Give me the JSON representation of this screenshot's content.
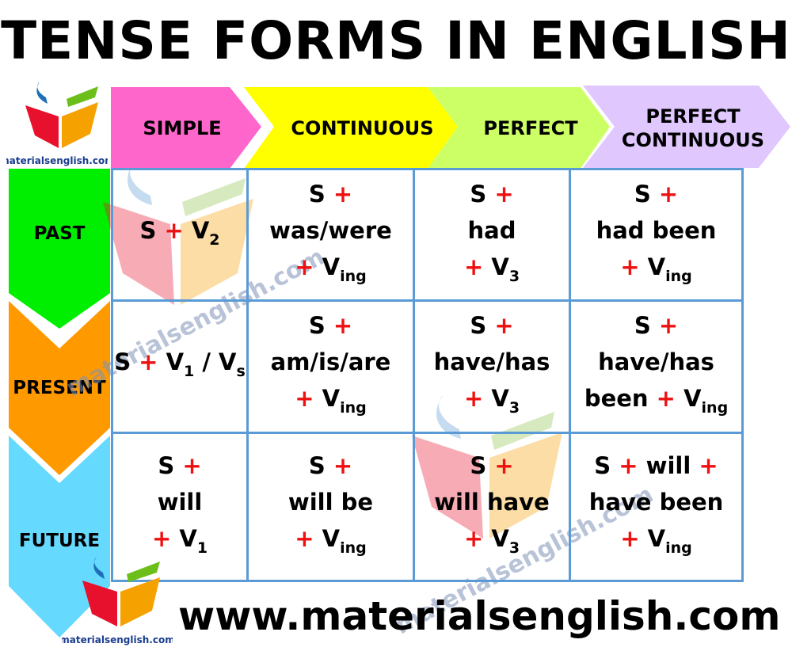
{
  "title": "TENSE FORMS IN ENGLISH",
  "logo": {
    "text": "materialsenglish.com",
    "icon": "open-book-logo-icon"
  },
  "colors": {
    "simple": "#ff66cc",
    "continuous": "#ffff00",
    "perfect": "#ccff66",
    "perfect_continuous": "#e0c8ff",
    "past": "#00ee00",
    "present": "#ff9900",
    "future": "#66d9ff",
    "grid_line": "#5b9bd5",
    "plus": "#ee1111"
  },
  "columns": [
    {
      "label": "SIMPLE"
    },
    {
      "label": "CONTINUOUS"
    },
    {
      "label": "PERFECT"
    },
    {
      "label": "PERFECT CONTINUOUS",
      "line1": "PERFECT",
      "line2": "CONTINUOUS"
    }
  ],
  "rows": [
    {
      "label": "PAST",
      "cells": [
        {
          "lines": [
            [
              {
                "t": "S "
              },
              {
                "p": "+"
              },
              {
                "t": " V"
              },
              {
                "s": "2"
              }
            ]
          ]
        },
        {
          "lines": [
            [
              {
                "t": "S "
              },
              {
                "p": "+"
              }
            ],
            [
              {
                "t": "was/were"
              }
            ],
            [
              {
                "p": "+"
              },
              {
                "t": " V"
              },
              {
                "s": "ing"
              }
            ]
          ]
        },
        {
          "lines": [
            [
              {
                "t": "S "
              },
              {
                "p": "+"
              }
            ],
            [
              {
                "t": "had"
              }
            ],
            [
              {
                "p": "+"
              },
              {
                "t": " V"
              },
              {
                "s": "3"
              }
            ]
          ]
        },
        {
          "lines": [
            [
              {
                "t": "S "
              },
              {
                "p": "+"
              }
            ],
            [
              {
                "t": "had been"
              }
            ],
            [
              {
                "p": "+"
              },
              {
                "t": " V"
              },
              {
                "s": "ing"
              }
            ]
          ]
        }
      ]
    },
    {
      "label": "PRESENT",
      "cells": [
        {
          "lines": [
            [
              {
                "t": "S "
              },
              {
                "p": "+"
              },
              {
                "t": " V"
              },
              {
                "s": "1"
              },
              {
                "t": " / V"
              },
              {
                "s": "s"
              }
            ]
          ]
        },
        {
          "lines": [
            [
              {
                "t": "S "
              },
              {
                "p": "+"
              }
            ],
            [
              {
                "t": "am/is/are"
              }
            ],
            [
              {
                "p": "+"
              },
              {
                "t": " V"
              },
              {
                "s": "ing"
              }
            ]
          ]
        },
        {
          "lines": [
            [
              {
                "t": "S "
              },
              {
                "p": "+"
              }
            ],
            [
              {
                "t": "have/has"
              }
            ],
            [
              {
                "p": "+"
              },
              {
                "t": " V"
              },
              {
                "s": "3"
              }
            ]
          ]
        },
        {
          "lines": [
            [
              {
                "t": "S "
              },
              {
                "p": "+"
              }
            ],
            [
              {
                "t": "have/has"
              }
            ],
            [
              {
                "t": "been "
              },
              {
                "p": "+"
              },
              {
                "t": " V"
              },
              {
                "s": "ing"
              }
            ]
          ]
        }
      ]
    },
    {
      "label": "FUTURE",
      "cells": [
        {
          "lines": [
            [
              {
                "t": "S "
              },
              {
                "p": "+"
              }
            ],
            [
              {
                "t": "will"
              }
            ],
            [
              {
                "p": "+"
              },
              {
                "t": " V"
              },
              {
                "s": "1"
              }
            ]
          ]
        },
        {
          "lines": [
            [
              {
                "t": "S "
              },
              {
                "p": "+"
              }
            ],
            [
              {
                "t": "will be"
              }
            ],
            [
              {
                "p": "+"
              },
              {
                "t": " V"
              },
              {
                "s": "ing"
              }
            ]
          ]
        },
        {
          "lines": [
            [
              {
                "t": "S "
              },
              {
                "p": "+"
              }
            ],
            [
              {
                "t": "will have"
              }
            ],
            [
              {
                "p": "+"
              },
              {
                "t": " V"
              },
              {
                "s": "3"
              }
            ]
          ]
        },
        {
          "lines": [
            [
              {
                "t": "S "
              },
              {
                "p": "+"
              },
              {
                "t": " will "
              },
              {
                "p": "+"
              }
            ],
            [
              {
                "t": "have been"
              }
            ],
            [
              {
                "p": "+"
              },
              {
                "t": " V"
              },
              {
                "s": "ing"
              }
            ]
          ]
        }
      ]
    }
  ],
  "watermark": "materialsenglish.com",
  "footer": "www.materialsenglish.com"
}
